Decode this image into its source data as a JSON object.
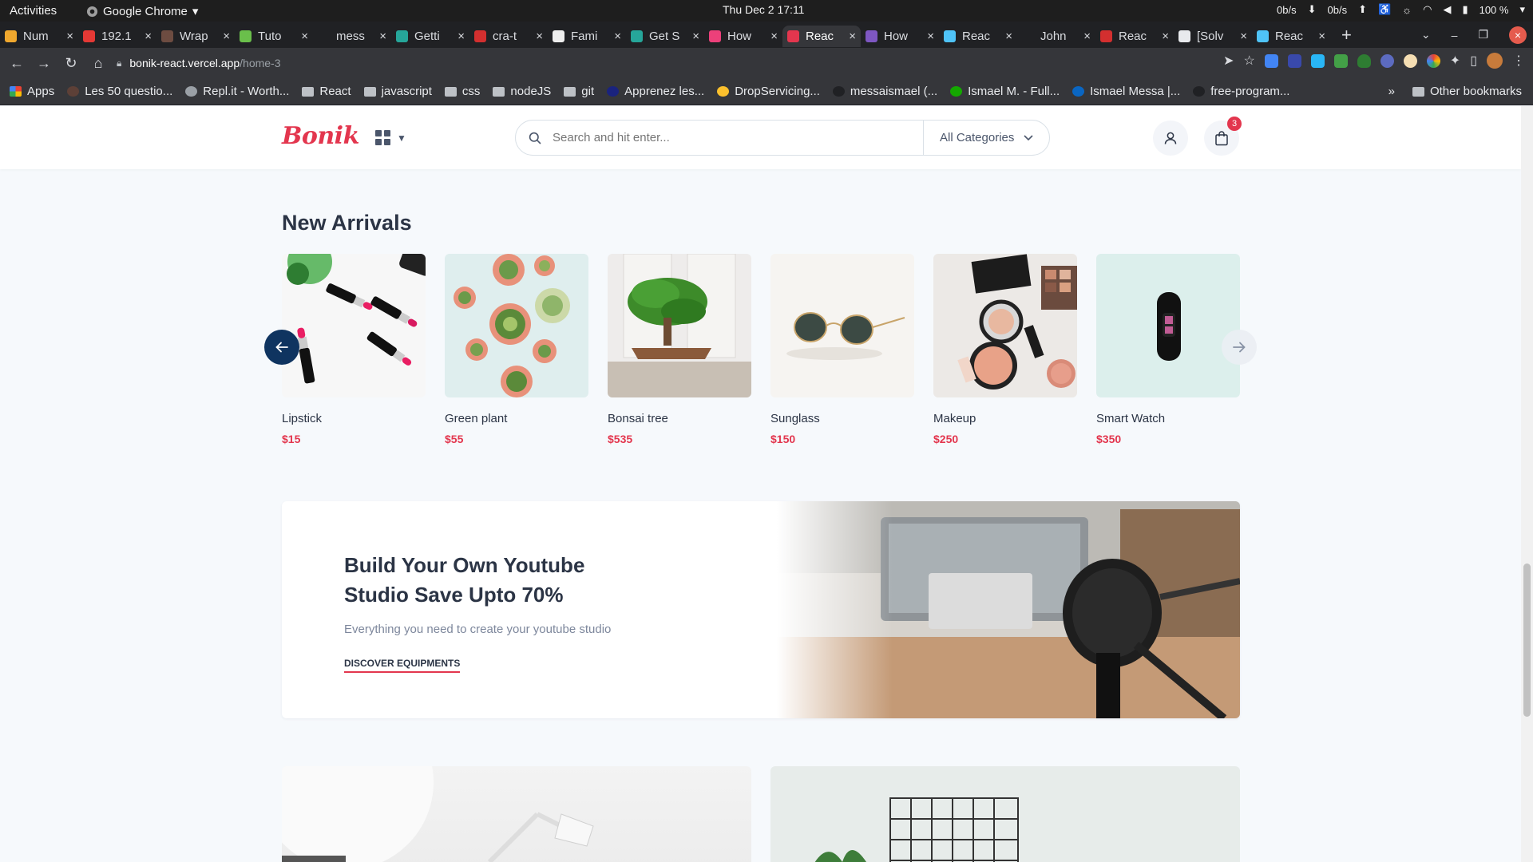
{
  "system": {
    "activities": "Activities",
    "app": "Google Chrome",
    "clock": "Thu Dec 2  17:11",
    "net_down": "0b/s",
    "net_up": "0b/s",
    "battery": "100 %"
  },
  "tabs": [
    {
      "label": "Num",
      "color": "#f0a82e"
    },
    {
      "label": "192.1",
      "color": "#e53935"
    },
    {
      "label": "Wrap",
      "color": "#6d4c41"
    },
    {
      "label": "Tuto",
      "color": "#6abf4b"
    },
    {
      "label": "mess",
      "color": "#202124"
    },
    {
      "label": "Getti",
      "color": "#26a69a"
    },
    {
      "label": "cra-t",
      "color": "#d32f2f"
    },
    {
      "label": "Fami",
      "color": "#eeeeee"
    },
    {
      "label": "Get S",
      "color": "#26a69a"
    },
    {
      "label": "How",
      "color": "#ec407a"
    },
    {
      "label": "Reac",
      "color": "#e3364e",
      "active": true
    },
    {
      "label": "How",
      "color": "#7e57c2"
    },
    {
      "label": "Reac",
      "color": "#4fc3f7"
    },
    {
      "label": "John",
      "color": "#202124"
    },
    {
      "label": "Reac",
      "color": "#d32f2f"
    },
    {
      "label": "[Solv",
      "color": "#e8eaed"
    },
    {
      "label": "Reac",
      "color": "#4fc3f7"
    }
  ],
  "omnibox": {
    "host": "bonik-react.vercel.app",
    "path": "/home-3"
  },
  "bookmarks": [
    {
      "label": "Apps",
      "type": "apps"
    },
    {
      "label": "Les 50 questio...",
      "type": "site",
      "color": "#5d4037"
    },
    {
      "label": "Repl.it - Worth...",
      "type": "site",
      "color": "#9aa0a6"
    },
    {
      "label": "React",
      "type": "folder"
    },
    {
      "label": "javascript",
      "type": "folder"
    },
    {
      "label": "css",
      "type": "folder"
    },
    {
      "label": "nodeJS",
      "type": "folder"
    },
    {
      "label": "git",
      "type": "folder"
    },
    {
      "label": "Apprenez les...",
      "type": "site",
      "color": "#1a237e"
    },
    {
      "label": "DropServicing...",
      "type": "site",
      "color": "#fbc02d"
    },
    {
      "label": "messaismael (...",
      "type": "site",
      "color": "#202124"
    },
    {
      "label": "Ismael M. - Full...",
      "type": "site",
      "color": "#14a800"
    },
    {
      "label": "Ismael Messa |...",
      "type": "site",
      "color": "#0a66c2"
    },
    {
      "label": "free-program...",
      "type": "site",
      "color": "#202124"
    }
  ],
  "bookmarks_more": "»",
  "other_bookmarks": "Other bookmarks",
  "site": {
    "logo": "Bonik",
    "search_placeholder": "Search and hit enter...",
    "category_select": "All Categories",
    "cart_count": "3"
  },
  "new_arrivals": {
    "title": "New Arrivals",
    "products": [
      {
        "name": "Lipstick",
        "price": "$15"
      },
      {
        "name": "Green plant",
        "price": "$55"
      },
      {
        "name": "Bonsai tree",
        "price": "$535"
      },
      {
        "name": "Sunglass",
        "price": "$150"
      },
      {
        "name": "Makeup",
        "price": "$250"
      },
      {
        "name": "Smart Watch",
        "price": "$350"
      }
    ]
  },
  "banner": {
    "title": "Build Your Own Youtube Studio Save Upto 70%",
    "subtitle": "Everything you need to create your youtube studio",
    "cta": "DISCOVER EQUIPMENTS"
  },
  "colors": {
    "brand": "#e3364e",
    "navy": "#0f3460",
    "text": "#2b3445"
  }
}
